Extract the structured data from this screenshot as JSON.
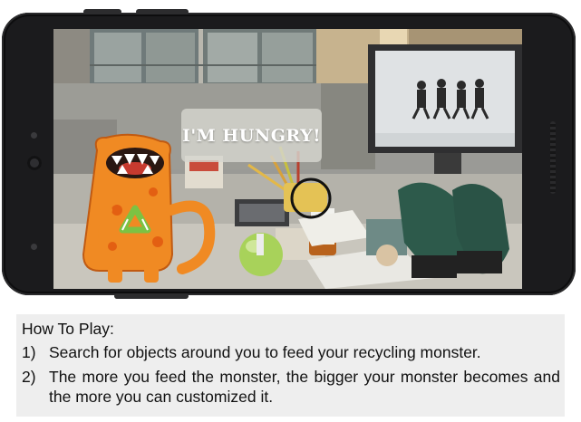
{
  "game": {
    "speech_bubble": "I'M HUNGRY!",
    "character": "recycling-monster",
    "target_indicator": "circle-reticle"
  },
  "instructions": {
    "title": "How To Play:",
    "steps": [
      {
        "number": "1)",
        "text": "Search for objects around you to feed your recycling monster."
      },
      {
        "number": "2)",
        "text": "The more you feed the monster, the bigger your monster becomes and the more you can customized it."
      }
    ]
  },
  "colors": {
    "phone_frame": "#1b1b1d",
    "monster_orange": "#f08a23",
    "recycle_green": "#7cc243",
    "panel_bg": "#eeeeee"
  }
}
